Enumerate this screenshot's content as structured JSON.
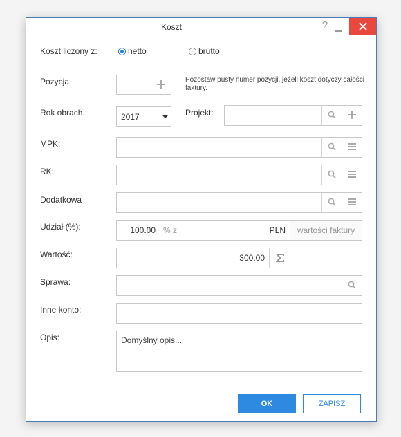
{
  "window": {
    "title": "Koszt",
    "help": "?"
  },
  "basis": {
    "label": "Koszt liczony z:",
    "options": [
      "netto",
      "brutto"
    ],
    "selected": "netto"
  },
  "position": {
    "label": "Pozycja",
    "hint": "Pozostaw pusty numer pozycji, jeżeli koszt dotyczy całości faktury.",
    "value": ""
  },
  "fiscal_year": {
    "label": "Rok obrach.:",
    "value": "2017"
  },
  "project": {
    "label": "Projekt:",
    "value": ""
  },
  "mpk": {
    "label": "MPK:",
    "value": ""
  },
  "rk": {
    "label": "RK:",
    "value": ""
  },
  "extra": {
    "label": "Dodatkowa",
    "value": ""
  },
  "share": {
    "label": "Udział (%):",
    "value": "100.00",
    "pct_suffix": "% z",
    "currency": "PLN",
    "of_text": "wartości faktury"
  },
  "amount": {
    "label": "Wartość:",
    "value": "300.00"
  },
  "matter": {
    "label": "Sprawa:",
    "value": ""
  },
  "other_account": {
    "label": "Inne konto:",
    "value": ""
  },
  "description": {
    "label": "Opis:",
    "value": "Domyślny opis..."
  },
  "buttons": {
    "ok": "OK",
    "save": "ZAPISZ"
  },
  "icons": {
    "search": "search-icon",
    "add": "plus-icon",
    "list": "list-icon",
    "sum": "sigma-icon",
    "close": "close-icon",
    "minimize": "minimize-icon"
  },
  "colors": {
    "accent": "#2e89e0",
    "close": "#e8483d",
    "border": "#4a7ab8"
  }
}
